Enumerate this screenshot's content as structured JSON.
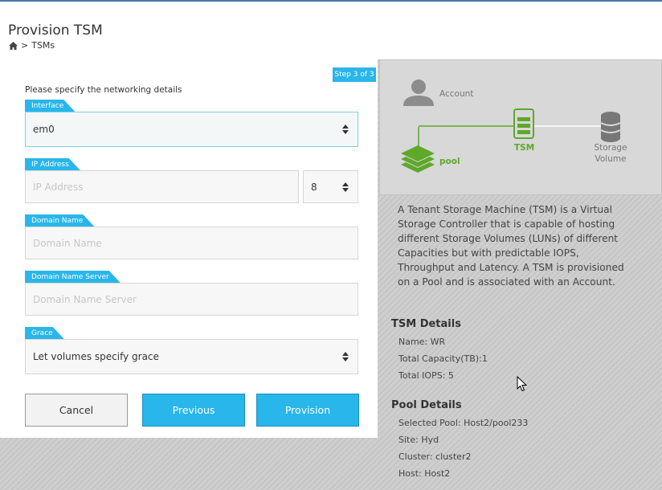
{
  "header": {
    "title": "Provision TSM",
    "breadcrumb_separator": ">",
    "breadcrumb_current": "TSMs"
  },
  "form": {
    "step_badge": "Step 3 of 3",
    "instructions": "Please specify the networking details",
    "interface": {
      "label": "Interface",
      "value": "em0"
    },
    "ip_address": {
      "label": "IP Address",
      "placeholder": "IP Address",
      "prefix_value": "8"
    },
    "domain_name": {
      "label": "Domain Name",
      "placeholder": "Domain Name"
    },
    "domain_name_server": {
      "label": "Domain Name Server",
      "placeholder": "Domain Name Server"
    },
    "grace": {
      "label": "Grace",
      "value": "Let volumes specify grace"
    },
    "buttons": {
      "cancel": "Cancel",
      "previous": "Previous",
      "provision": "Provision"
    }
  },
  "diagram": {
    "account_label": "Account",
    "pool_label": "pool",
    "tsm_label": "TSM",
    "storage_label_line1": "Storage",
    "storage_label_line2": "Volume"
  },
  "info": {
    "description": "A Tenant Storage Machine (TSM) is a Virtual Storage Controller that is capable of hosting different Storage Volumes (LUNs) of different Capacities but with predictable IOPS, Throughput and Latency. A TSM is provisioned on a Pool and is associated with an Account.",
    "tsm_details": {
      "heading": "TSM Details",
      "name": "Name: WR",
      "capacity": "Total Capacity(TB):1",
      "iops": "Total IOPS: 5"
    },
    "pool_details": {
      "heading": "Pool Details",
      "selected_pool": "Selected Pool: Host2/pool233",
      "site": "Site: Hyd",
      "cluster": "Cluster: cluster2",
      "host": "Host: Host2"
    }
  },
  "colors": {
    "accent_blue": "#29b6ea",
    "diagram_green": "#5ea82a",
    "top_rule": "#4a78a8"
  },
  "icons": [
    "home-icon",
    "user-icon",
    "layers-icon",
    "server-icon",
    "database-icon",
    "mouse-cursor-icon"
  ]
}
